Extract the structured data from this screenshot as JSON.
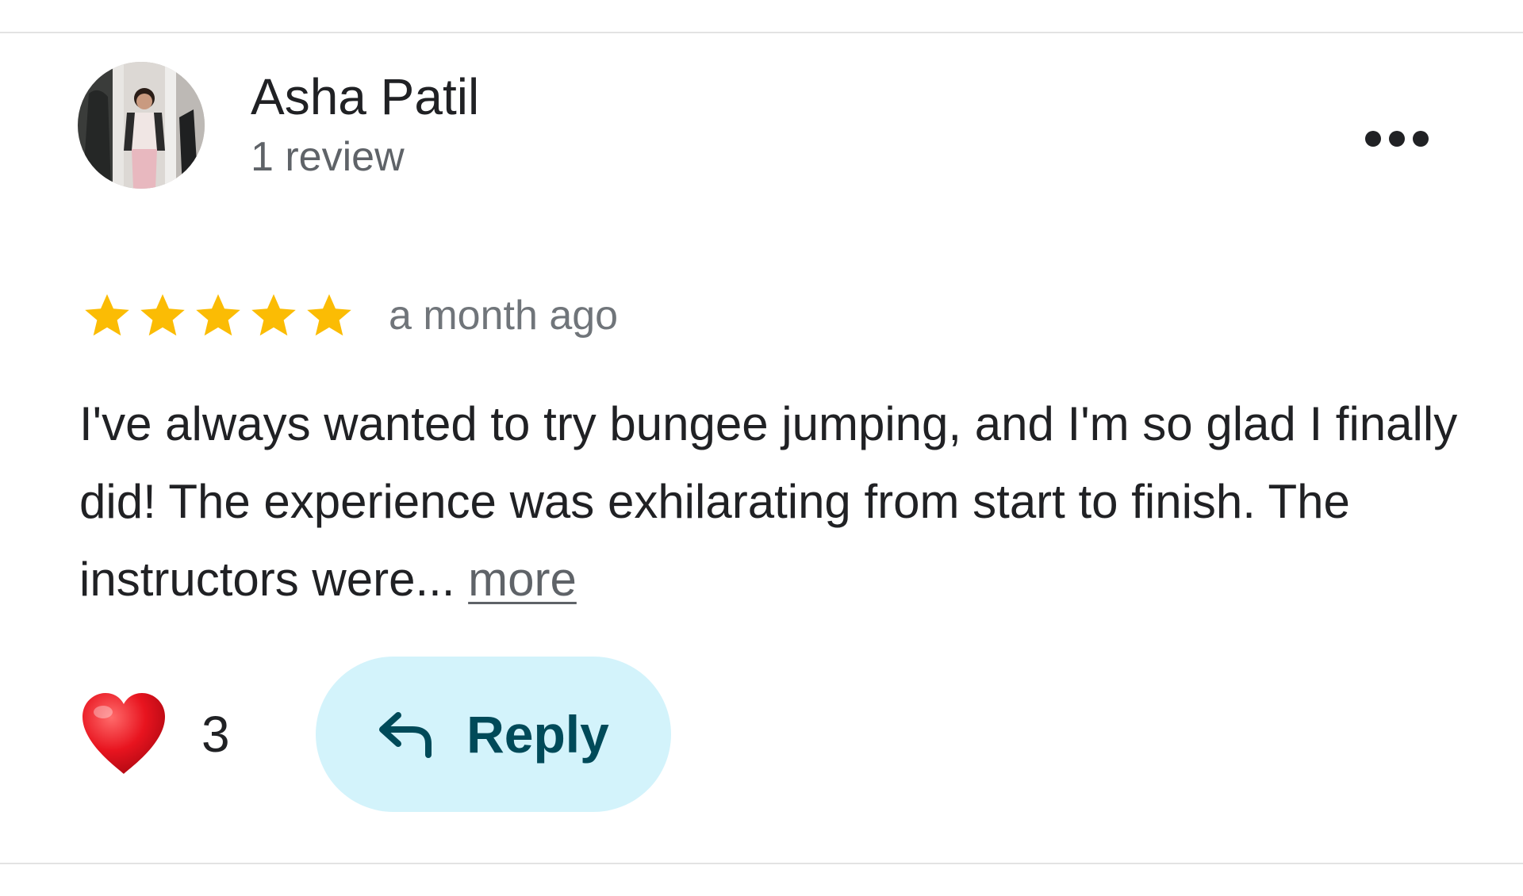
{
  "review": {
    "author_name": "Asha Patil",
    "author_review_count": "1 review",
    "rating": 5,
    "rating_max": 5,
    "date": "a month ago",
    "text": "I've always wanted to try bungee jumping, and I'm so glad I finally did! The experience was exhilarating from start to finish. The instructors were... ",
    "more_label": "more",
    "likes": "3",
    "reply_label": "Reply"
  },
  "colors": {
    "star": "#FBBC04",
    "reply_bg": "#D3F3FB",
    "reply_text": "#004A59",
    "heart": "#E0101C"
  },
  "icons": {
    "options": "more-horiz-icon",
    "like": "heart-icon",
    "reply": "reply-arrow-icon"
  }
}
